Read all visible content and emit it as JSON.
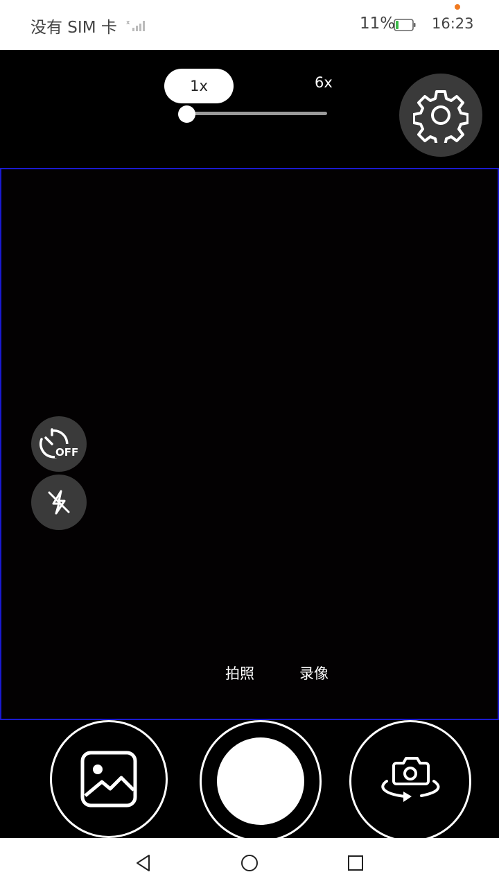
{
  "status_bar": {
    "carrier": "没有 SIM 卡",
    "battery": "11%",
    "time": "16:23"
  },
  "zoom": {
    "current": "1x",
    "max": "6x",
    "level": 0
  },
  "modes": {
    "photo": "拍照",
    "video": "录像"
  },
  "icons": {
    "settings": "gear-icon",
    "timer": "timer-off-icon",
    "flash": "flash-off-icon",
    "gallery": "image-icon",
    "switch_camera": "camera-switch-icon"
  },
  "colors": {
    "preview_border": "#1a1ad0",
    "control_bg": "#3a3a3a",
    "battery_low": "#3cb94a",
    "notification": "#f07a20"
  }
}
